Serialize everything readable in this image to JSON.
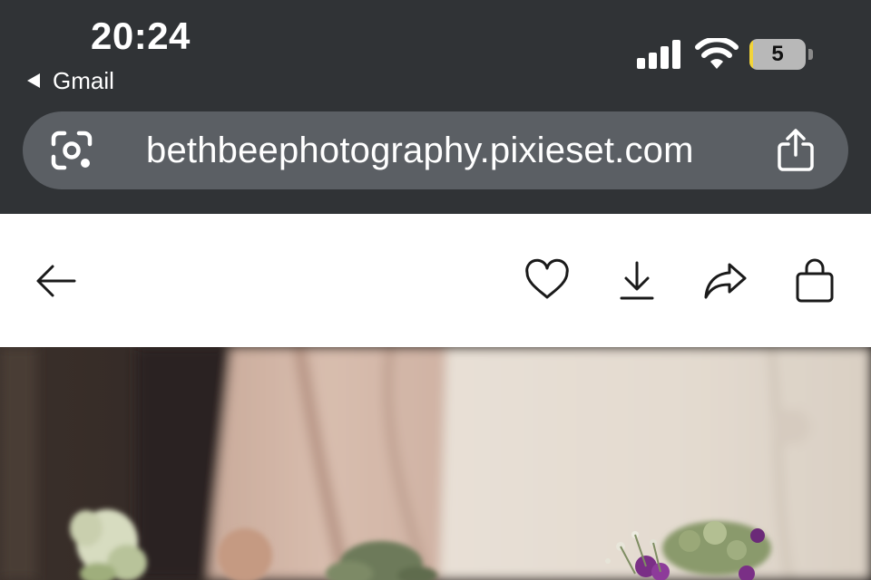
{
  "status_bar": {
    "time": "20:24",
    "back_app_label": "Gmail",
    "battery_level": "5",
    "battery_fraction": 0.05,
    "icons": [
      "cellular-signal-icon",
      "wifi-icon",
      "battery-icon"
    ]
  },
  "browser": {
    "url": "bethbeephotography.pixieset.com",
    "left_icon": "google-lens-icon",
    "right_icon": "share-icon"
  },
  "toolbar": {
    "icons": [
      "back-arrow-icon",
      "heart-icon",
      "download-icon",
      "share-arrow-icon",
      "shopping-bag-icon"
    ]
  },
  "colors": {
    "chrome_bg": "#303336",
    "urlbar_bg": "#5b5f64",
    "page_bg": "#ffffff",
    "icon_dark": "#1a1a1a",
    "battery_low": "#f2d43a"
  }
}
